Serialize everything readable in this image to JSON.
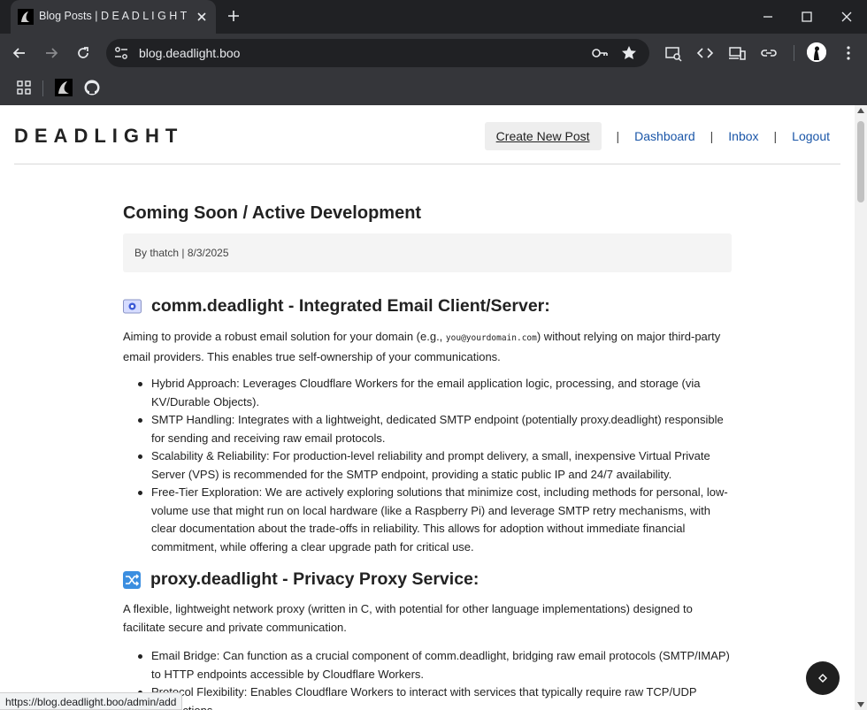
{
  "browser": {
    "tab_title": "Blog Posts | D E A D L I G H T",
    "url": "blog.deadlight.boo",
    "status_url": "https://blog.deadlight.boo/admin/add"
  },
  "site": {
    "logo": "DEADLIGHT",
    "nav": {
      "create": "Create New Post",
      "dashboard": "Dashboard",
      "inbox": "Inbox",
      "logout": "Logout",
      "separator": "|"
    }
  },
  "post": {
    "title": "Coming Soon / Active Development",
    "meta": "By thatch | 8/3/2025",
    "sections": [
      {
        "heading": "comm.deadlight - Integrated Email Client/Server:",
        "icon": "email-icon",
        "intro_before": "Aiming to provide a robust email solution for your domain (e.g., ",
        "intro_code": "you@yourdomain.com",
        "intro_after": ") without relying on major third-party email providers. This enables true self-ownership of your communications.",
        "items": [
          "Hybrid Approach: Leverages Cloudflare Workers for the email application logic, processing, and storage (via KV/Durable Objects).",
          "SMTP Handling: Integrates with a lightweight, dedicated SMTP endpoint (potentially proxy.deadlight) responsible for sending and receiving raw email protocols.",
          "Scalability & Reliability: For production-level reliability and prompt delivery, a small, inexpensive Virtual Private Server (VPS) is recommended for the SMTP endpoint, providing a static public IP and 24/7 availability.",
          "Free-Tier Exploration: We are actively exploring solutions that minimize cost, including methods for personal, low-volume use that might run on local hardware (like a Raspberry Pi) and leverage SMTP retry mechanisms, with clear documentation about the trade-offs in reliability. This allows for adoption without immediate financial commitment, while offering a clear upgrade path for critical use."
        ]
      },
      {
        "heading": "proxy.deadlight - Privacy Proxy Service:",
        "icon": "shuffle-icon",
        "intro": "A flexible, lightweight network proxy (written in C, with potential for other language implementations) designed to facilitate secure and private communication.",
        "items": [
          "Email Bridge: Can function as a crucial component of comm.deadlight, bridging raw email protocols (SMTP/IMAP) to HTTP endpoints accessible by Cloudflare Workers.",
          "Protocol Flexibility: Enables Cloudflare Workers to interact with services that typically require raw TCP/UDP connections."
        ]
      }
    ]
  },
  "colors": {
    "link": "#1a56a8",
    "chrome_dark": "#202124",
    "chrome_toolbar": "#35363a"
  }
}
